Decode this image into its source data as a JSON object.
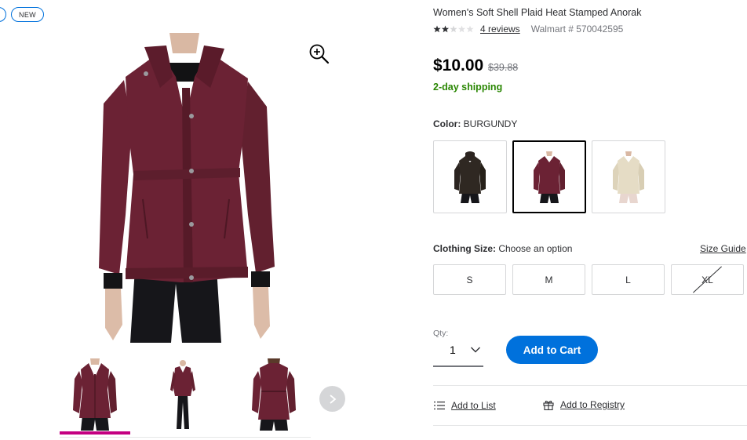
{
  "badges": {
    "first": "",
    "new": "NEW"
  },
  "gallery": {
    "main_image_alt": "Women's burgundy soft shell jacket, front view",
    "zoom_icon": "zoom-in-icon",
    "thumbnails": [
      {
        "view": "front-closeup",
        "selected": true
      },
      {
        "view": "full-length-front",
        "selected": false
      },
      {
        "view": "back-view",
        "selected": false
      }
    ],
    "next_icon": "chevron-right-icon",
    "active_color": "#c40081"
  },
  "product": {
    "title": "Women's Soft Shell Plaid Heat Stamped Anorak",
    "rating": 2.5,
    "rating_max": 5,
    "reviews": "4 reviews",
    "item_number": "Walmart # 570042595",
    "price": "$10.00",
    "was_price": "$39.88",
    "shipping": "2-day shipping"
  },
  "color": {
    "label": "Color:",
    "value": "BURGUNDY",
    "options": [
      {
        "name": "black",
        "hex": "#2b2420",
        "selected": false
      },
      {
        "name": "burgundy",
        "hex": "#6b2234",
        "selected": true
      },
      {
        "name": "beige",
        "hex": "#e5dcc5",
        "selected": false
      }
    ]
  },
  "size": {
    "label": "Clothing Size:",
    "value": "Choose an option",
    "guide": "Size Guide",
    "options": [
      {
        "label": "S",
        "available": true
      },
      {
        "label": "M",
        "available": true
      },
      {
        "label": "L",
        "available": true
      },
      {
        "label": "XL",
        "available": false
      }
    ]
  },
  "quantity": {
    "label": "Qty:",
    "value": "1"
  },
  "actions": {
    "add_to_cart": "Add to Cart",
    "add_to_list": "Add to List",
    "add_to_registry": "Add to Registry"
  },
  "colors": {
    "primary": "#0071dc",
    "shipping_green": "#2a8703",
    "jacket": "#6b2234"
  }
}
